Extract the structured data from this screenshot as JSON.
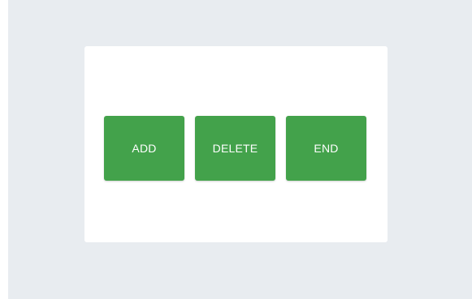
{
  "colors": {
    "page_background": "#e8ecf0",
    "card_background": "#ffffff",
    "button_background": "#43a24b",
    "button_text": "#ffffff"
  },
  "buttons": {
    "add_label": "ADD",
    "delete_label": "DELETE",
    "end_label": "END"
  }
}
